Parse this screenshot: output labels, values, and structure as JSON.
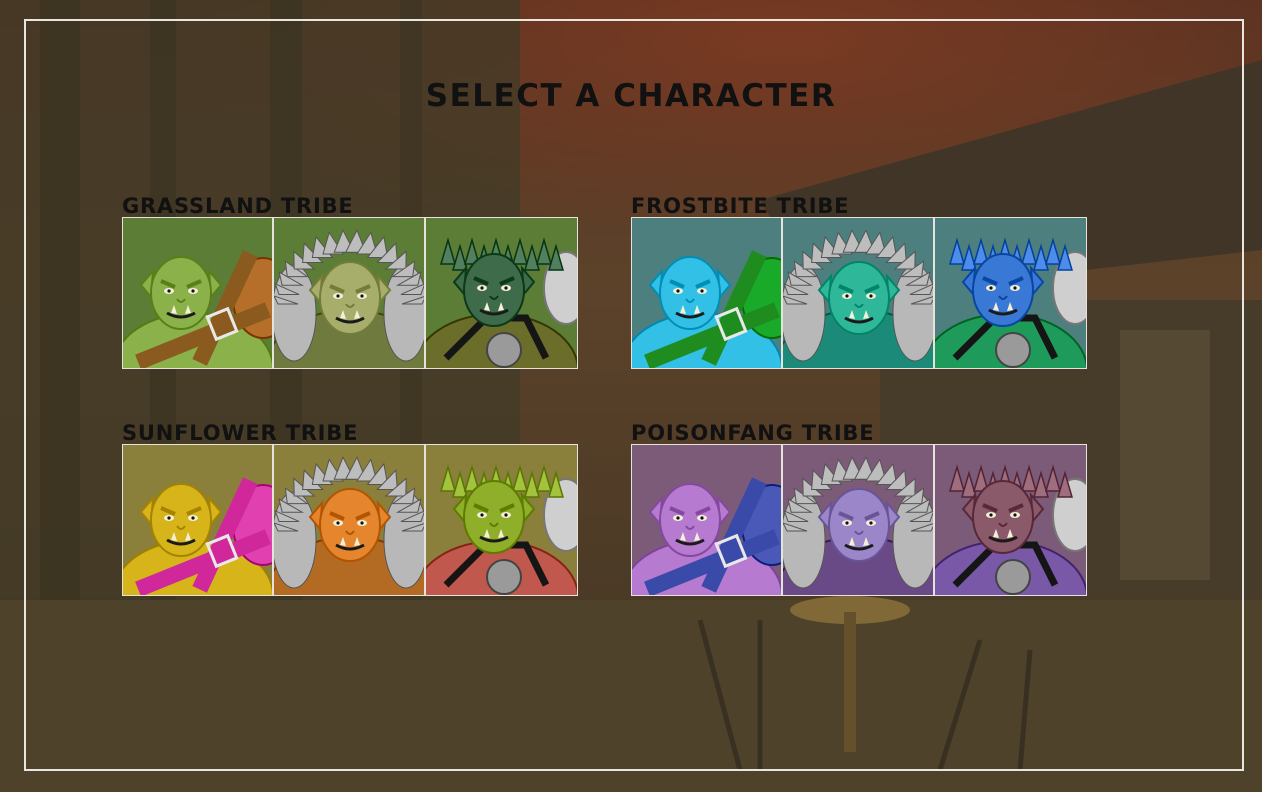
{
  "screen_title": "SELECT A CHARACTER",
  "tribes": [
    {
      "name": "GRASSLAND TRIBE",
      "tint": "#5a7d36",
      "characters": [
        {
          "icon": "orc-brute-icon",
          "variant": "brute",
          "skin": "#8bb24a",
          "bg": "#5b7d35",
          "gear": "#8a5a1e",
          "gear2": "#b56f2a"
        },
        {
          "icon": "orc-furcloak-icon",
          "variant": "fur",
          "skin": "#a7ad6a",
          "bg": "#5b7d35",
          "gear": "#6e7a3e",
          "gear2": "#8c8c8c"
        },
        {
          "icon": "orc-spiked-icon",
          "variant": "spiked",
          "skin": "#3e6b4a",
          "bg": "#5b7d35",
          "gear": "#6b6e2a",
          "gear2": "#cfcfcf"
        }
      ]
    },
    {
      "name": "FROSTBITE TRIBE",
      "tint": "#4a7a78",
      "characters": [
        {
          "icon": "orc-brute-icon",
          "variant": "brute",
          "skin": "#33c0e6",
          "bg": "#4d7f7e",
          "gear": "#1f8c1f",
          "gear2": "#1aaa2a"
        },
        {
          "icon": "orc-furcloak-icon",
          "variant": "fur",
          "skin": "#2fb79a",
          "bg": "#4d7f7e",
          "gear": "#1c8a78",
          "gear2": "#8c8c8c"
        },
        {
          "icon": "orc-spiked-icon",
          "variant": "spiked",
          "skin": "#3a78d6",
          "bg": "#4d7f7e",
          "gear": "#1e9a5a",
          "gear2": "#cfcfcf"
        }
      ]
    },
    {
      "name": "SUNFLOWER TRIBE",
      "tint": "#8a7e3a",
      "characters": [
        {
          "icon": "orc-brute-icon",
          "variant": "brute",
          "skin": "#d7b51a",
          "bg": "#8a7f3b",
          "gear": "#d0289a",
          "gear2": "#e040b0"
        },
        {
          "icon": "orc-furcloak-icon",
          "variant": "fur",
          "skin": "#e5862e",
          "bg": "#8a7f3b",
          "gear": "#b36a22",
          "gear2": "#8c8c8c"
        },
        {
          "icon": "orc-spiked-icon",
          "variant": "spiked",
          "skin": "#8fae2a",
          "bg": "#8a7f3b",
          "gear": "#c0584e",
          "gear2": "#cfcfcf"
        }
      ]
    },
    {
      "name": "POISONFANG TRIBE",
      "tint": "#7b5a76",
      "characters": [
        {
          "icon": "orc-brute-icon",
          "variant": "brute",
          "skin": "#b67ad0",
          "bg": "#7c5b78",
          "gear": "#3a4aa8",
          "gear2": "#4a58b8"
        },
        {
          "icon": "orc-furcloak-icon",
          "variant": "fur",
          "skin": "#9a86c8",
          "bg": "#7c5b78",
          "gear": "#6a4a86",
          "gear2": "#8c8c8c"
        },
        {
          "icon": "orc-spiked-icon",
          "variant": "spiked",
          "skin": "#8a5a6a",
          "bg": "#7c5b78",
          "gear": "#7a58a8",
          "gear2": "#cfcfcf"
        }
      ]
    }
  ]
}
